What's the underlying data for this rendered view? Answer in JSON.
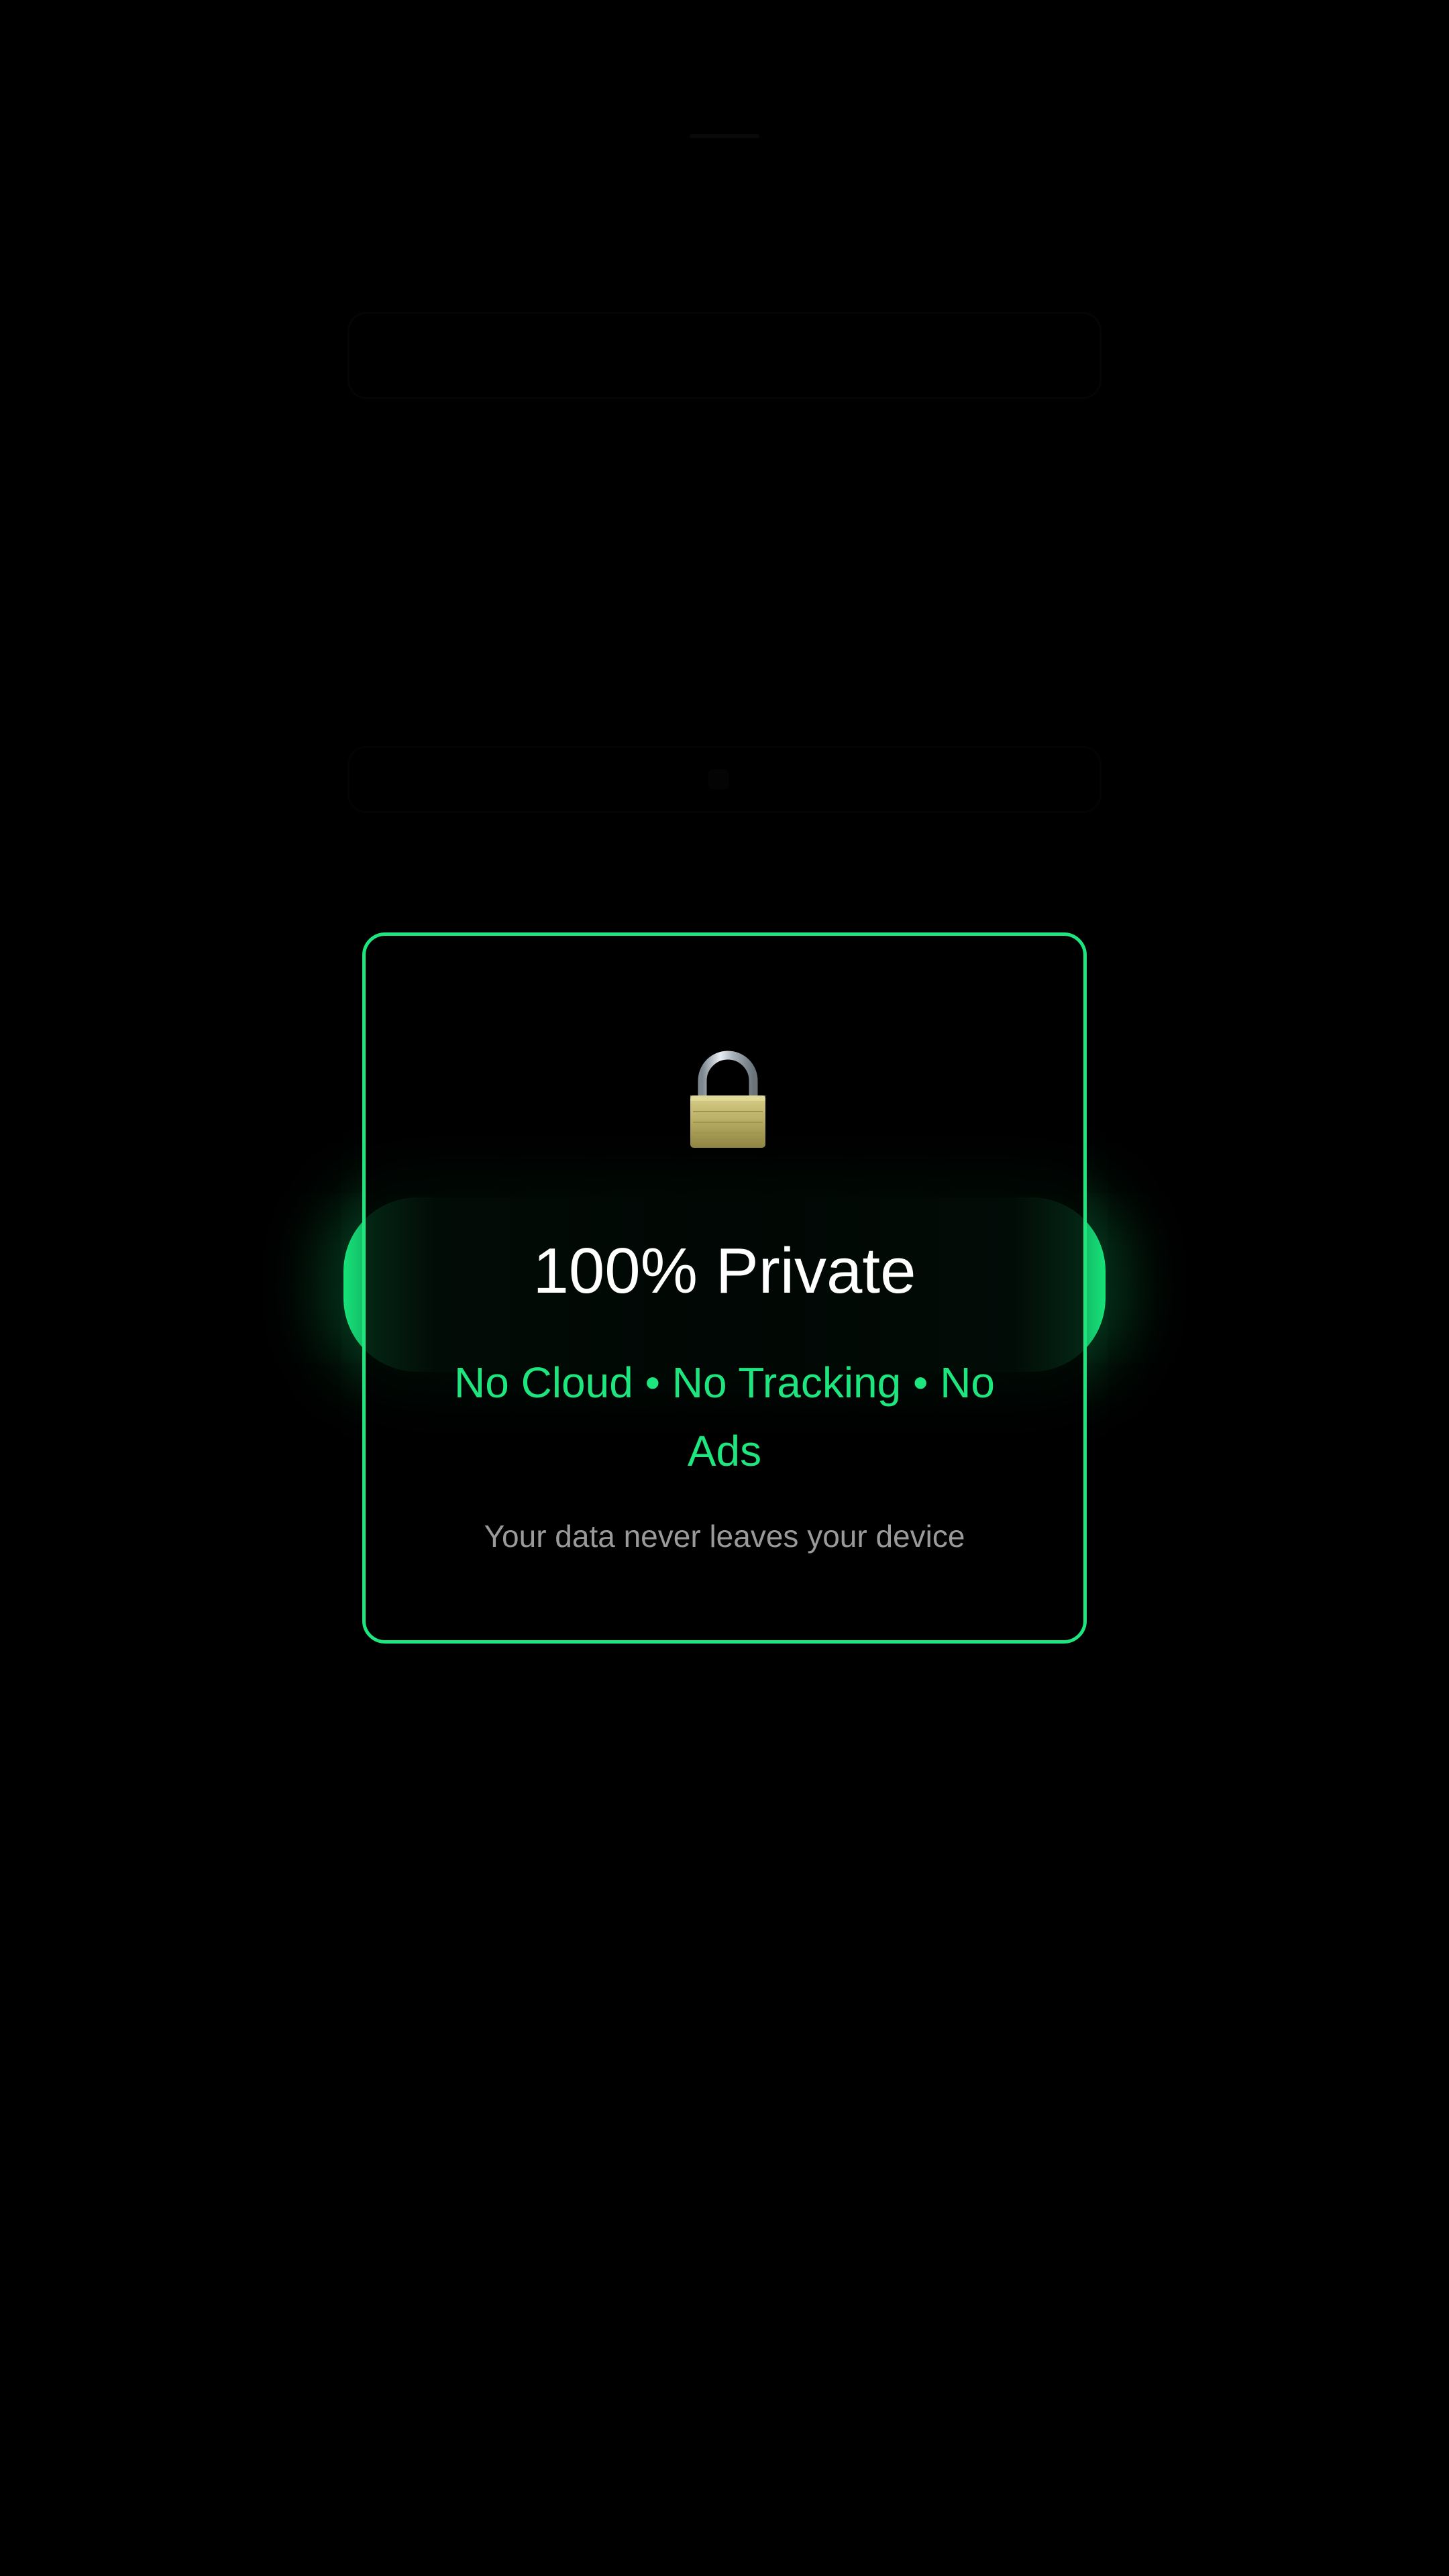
{
  "background_app": {
    "title": "",
    "input_placeholder": "",
    "columns": [
      {
        "label": "",
        "empty_text": ""
      },
      {
        "label": "",
        "empty_text": ""
      }
    ],
    "coach_button_label": "",
    "footer_links": ""
  },
  "privacy_card": {
    "icon": "lock-icon",
    "title": "100% Private",
    "features": "No Cloud • No Tracking • No Ads",
    "note": "Your data never leaves your device"
  },
  "colors": {
    "accent": "#1ee67f",
    "background": "#000000",
    "note_text": "#9a9a9a"
  }
}
